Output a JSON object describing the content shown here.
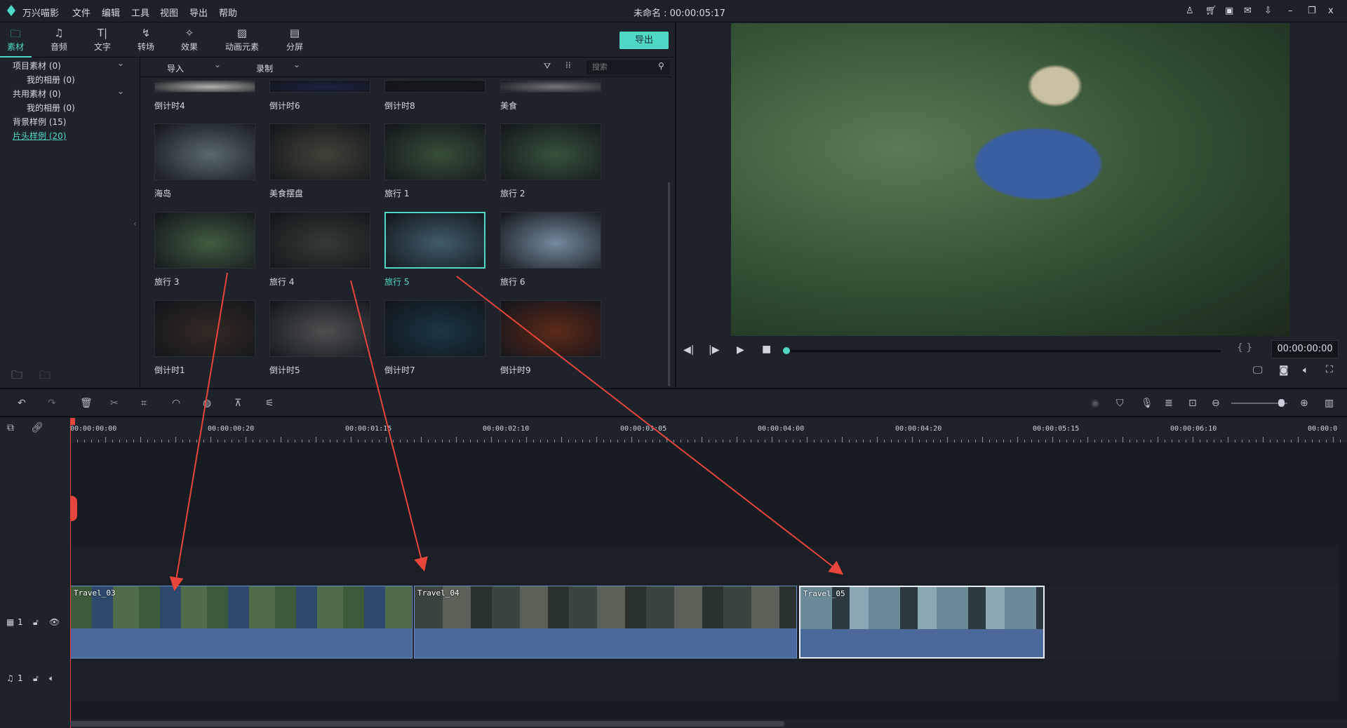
{
  "menubar": {
    "app": "万兴喵影",
    "items": [
      "文件",
      "编辑",
      "工具",
      "视图",
      "导出",
      "帮助"
    ],
    "title": "未命名 : 00:00:05:17",
    "icons": [
      "user-icon",
      "cart-icon",
      "save-icon",
      "mail-icon",
      "download-icon",
      "minimize-icon",
      "restore-icon",
      "close-icon"
    ]
  },
  "tabs": [
    {
      "label": "素材",
      "icon": "folder"
    },
    {
      "label": "音频",
      "icon": "music"
    },
    {
      "label": "文字",
      "icon": "text"
    },
    {
      "label": "转场",
      "icon": "transition"
    },
    {
      "label": "效果",
      "icon": "effect"
    },
    {
      "label": "动画元素",
      "icon": "image"
    },
    {
      "label": "分屏",
      "icon": "split"
    }
  ],
  "export_label": "导出",
  "sidebar": {
    "items": [
      {
        "label": "项目素材 (0)",
        "indent": false
      },
      {
        "label": "我的相册 (0)",
        "indent": true
      },
      {
        "label": "共用素材 (0)",
        "indent": false
      },
      {
        "label": "我的相册 (0)",
        "indent": true
      },
      {
        "label": "背景样例 (15)",
        "indent": false
      },
      {
        "label": "片头样例 (20)",
        "indent": false,
        "active": true
      }
    ]
  },
  "media": {
    "import": "导入",
    "record": "录制",
    "search_placeholder": "搜索",
    "rows": [
      [
        "倒计时4",
        "倒计时6",
        "倒计时8",
        "美食"
      ],
      [
        "海岛",
        "美食摆盘",
        "旅行 1",
        "旅行 2"
      ],
      [
        "旅行 3",
        "旅行 4",
        "旅行 5",
        "旅行 6"
      ],
      [
        "倒计时1",
        "倒计时5",
        "倒计时7",
        "倒计时9"
      ]
    ],
    "selected": "旅行 5"
  },
  "preview": {
    "timecode": "00:00:00:00",
    "progress": 0
  },
  "timeline": {
    "ruler": [
      "00:00:00:00",
      "00:00:00:20",
      "00:00:01:15",
      "00:00:02:10",
      "00:00:03:05",
      "00:00:04:00",
      "00:00:04:20",
      "00:00:05:15",
      "00:00:06:10",
      "00:00:0"
    ],
    "clips": [
      {
        "name": "Travel_03"
      },
      {
        "name": "Travel_04"
      },
      {
        "name": "Travel_05",
        "selected": true
      }
    ],
    "video_track": "1",
    "audio_track": "1"
  },
  "colors": {
    "accent": "#4fd8c6",
    "clip": "#4a689c",
    "annotation": "#e8453c"
  }
}
